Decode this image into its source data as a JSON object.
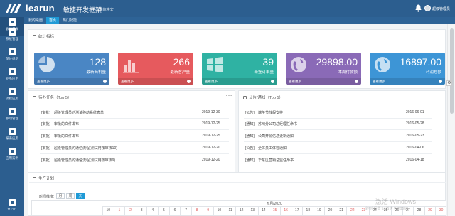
{
  "header": {
    "brand": "learun",
    "title": "敏捷开发框架",
    "subtitle": "(简体中文)",
    "user": "超级管理员"
  },
  "sidebar": {
    "items": [
      {
        "label": "敏捷开发",
        "icon": "home-icon"
      },
      {
        "label": "系统管理",
        "icon": "monitor-icon"
      },
      {
        "label": "单位组织",
        "icon": "org-icon"
      },
      {
        "label": "业务应用",
        "icon": "app-icon"
      },
      {
        "label": "流程应用",
        "icon": "flow-icon"
      },
      {
        "label": "移动管理",
        "icon": "mobile-icon"
      },
      {
        "label": "报表应用",
        "icon": "report-icon"
      },
      {
        "label": "应用实例",
        "icon": "demo-icon"
      },
      {
        "label": "111111",
        "icon": "app-icon"
      }
    ]
  },
  "tabs": [
    {
      "label": "我的桌面"
    },
    {
      "label": "首页"
    },
    {
      "label": "热门功能"
    }
  ],
  "stats_panel": {
    "title": "统计指标"
  },
  "cards": [
    {
      "value": "128",
      "label": "最新商机量",
      "footer": "查看更多",
      "color": "#4a86c4",
      "icon": "pie-icon"
    },
    {
      "value": "266",
      "label": "最新客户量",
      "footer": "查看更多",
      "color": "#e65a5e",
      "icon": "bar-icon"
    },
    {
      "value": "39",
      "label": "新签订单量",
      "footer": "查看更多",
      "color": "#2fb2a3",
      "icon": "windows-icon"
    },
    {
      "value": "29898.00",
      "label": "本周付款额",
      "footer": "查看更多",
      "color": "#8a6ab7",
      "icon": "globe-icon"
    },
    {
      "value": "16897.00",
      "label": "利润总额",
      "footer": "查看更多",
      "color": "#3d95d6",
      "icon": "globe-icon"
    }
  ],
  "todo": {
    "title": "待办任务（Top 5）",
    "more": "• • •",
    "rows": [
      {
        "tag": "[审批]",
        "text": "超级管理员的测试移动系统表单",
        "date": "2019-12-30"
      },
      {
        "tag": "[审批]",
        "text": "审批的文件发布",
        "date": "2019-12-25"
      },
      {
        "tag": "[审批]",
        "text": "审批的文件发布",
        "date": "2019-12-25"
      },
      {
        "tag": "[审批]",
        "text": "超级管理员的通信流程(测试用按审核10)",
        "date": "2019-12-20"
      },
      {
        "tag": "[审批]",
        "text": "超级管理员的通信流程(测试用按审核9)",
        "date": "2019-12-20"
      }
    ]
  },
  "notice": {
    "title": "公告/通知（Top 5）",
    "rows": [
      {
        "tag": "[公告]",
        "text": "端午节放假安排",
        "date": "2016-06-01"
      },
      {
        "tag": "[通知]",
        "text": "苏州分公司总经理任命书",
        "date": "2016-05-28"
      },
      {
        "tag": "[通知]",
        "text": "公司开源信息更新通知",
        "date": "2016-05-23"
      },
      {
        "tag": "[公告]",
        "text": "全体员工体检通知",
        "date": "2016-04-06"
      },
      {
        "tag": "[通知]",
        "text": "华东区营销总监任命书",
        "date": "2016-04-18"
      }
    ]
  },
  "plan": {
    "title": "生产计划",
    "granularity_label": "时间维度:",
    "options": [
      "月",
      "周",
      "天"
    ],
    "selected": "天",
    "month": "五月/2020",
    "days": [
      "10",
      "1",
      "2",
      "3",
      "4",
      "5",
      "6",
      "7",
      "8",
      "9",
      "10",
      "11",
      "12",
      "13",
      "14",
      "15",
      "16",
      "17",
      "18",
      "19",
      "20",
      "21",
      "22",
      "23",
      "24",
      "25",
      "26",
      "27",
      "28",
      "29",
      "30"
    ]
  },
  "watermark": {
    "title": "激活 Windows",
    "sub": "转到\"设置\"以激活 Windows。"
  }
}
